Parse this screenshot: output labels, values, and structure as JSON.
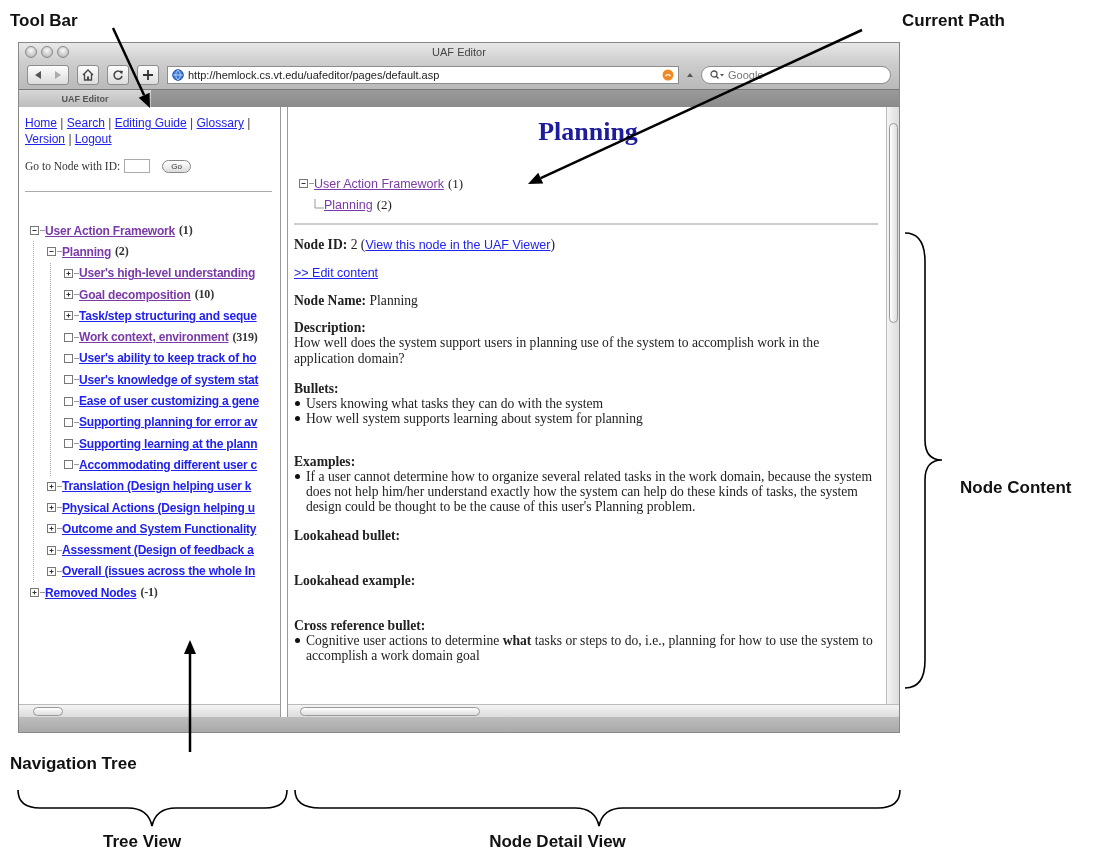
{
  "annotations": {
    "tool_bar": "Tool Bar",
    "current_path": "Current Path",
    "node_content": "Node Content",
    "navigation_tree": "Navigation Tree",
    "tree_view": "Tree View",
    "node_detail_view": "Node Detail View"
  },
  "window": {
    "title": "UAF Editor",
    "url": "http://hemlock.cs.vt.edu/uafeditor/pages/default.asp",
    "search_placeholder": "Google",
    "tabs": [
      {
        "label": "UAF Editor",
        "selected": true
      }
    ]
  },
  "tree_view": {
    "separator": "|",
    "links": [
      {
        "label": "Home"
      },
      {
        "label": "Search"
      },
      {
        "label": "Editing Guide"
      },
      {
        "label": "Glossary"
      },
      {
        "label": "Version"
      },
      {
        "label": "Logout"
      }
    ],
    "goto": {
      "label": "Go to Node with ID:",
      "button": "Go"
    },
    "tree": [
      {
        "label": "User Action Framework",
        "count": "(1)",
        "kind": "open",
        "visited": true,
        "children": [
          {
            "label": "Planning",
            "count": "(2)",
            "kind": "open",
            "visited": true,
            "children": [
              {
                "label": "User's high-level understanding",
                "kind": "closed",
                "visited": true
              },
              {
                "label": "Goal decomposition",
                "count": "(10)",
                "kind": "closed",
                "visited": true
              },
              {
                "label": "Task/step structuring and seque",
                "kind": "closed",
                "visited": false
              },
              {
                "label": "Work context, environment",
                "count": "(319)",
                "kind": "leaf",
                "visited": true
              },
              {
                "label": "User's ability to keep track of ho",
                "kind": "leaf",
                "visited": false
              },
              {
                "label": "User's knowledge of system stat",
                "kind": "leaf",
                "visited": false
              },
              {
                "label": "Ease of user customizing a gene",
                "kind": "leaf",
                "visited": false
              },
              {
                "label": "Supporting planning for error av",
                "kind": "leaf",
                "visited": false
              },
              {
                "label": "Supporting learning at the plann",
                "kind": "leaf",
                "visited": false
              },
              {
                "label": "Accommodating different user c",
                "kind": "leaf",
                "visited": false
              }
            ]
          },
          {
            "label": "Translation (Design helping user k",
            "kind": "closed",
            "visited": false
          },
          {
            "label": "Physical Actions (Design helping u",
            "kind": "closed",
            "visited": false
          },
          {
            "label": "Outcome and System Functionality",
            "kind": "closed",
            "visited": false
          },
          {
            "label": "Assessment (Design of feedback a",
            "kind": "closed",
            "visited": false
          },
          {
            "label": "Overall (issues across the whole In",
            "kind": "closed",
            "visited": false
          }
        ]
      },
      {
        "label": "Removed Nodes",
        "count": "(-1)",
        "kind": "closed",
        "visited": false
      }
    ]
  },
  "detail": {
    "title": "Planning",
    "path": [
      {
        "label": "User Action Framework",
        "count": "(1)",
        "children": [
          {
            "label": "Planning",
            "count": "(2)"
          }
        ]
      }
    ],
    "node_id": {
      "text": "**Node ID:** 2 (",
      "link": "View this node in the UAF Viewer",
      "after": ")"
    },
    "edit_link": ">> Edit content",
    "node_name": "**Node Name:** Planning",
    "sections": [
      {
        "heading": "Description:",
        "text": "How well does the system support users in planning use of the system to accomplish work in the application domain?"
      },
      {
        "heading": "Bullets:",
        "bullets": [
          "Users knowing what tasks they can do with the system",
          "How well system supports learning about system for planning"
        ]
      },
      {
        "heading": "Examples:",
        "bullets": [
          "If a user cannot determine how to organize several related tasks in the work domain, because the system does not help him/her understand exactly how the system can help do these kinds of tasks, the system design could be thought to be the cause of this user's Planning problem."
        ]
      },
      {
        "heading": "Lookahead bullet:"
      },
      {
        "heading": "Lookahead example:"
      },
      {
        "heading": "Cross reference bullet:",
        "bullets": [
          "Cognitive user actions to determine **what** tasks or steps to do, i.e., planning for how to use the system to accomplish a work domain goal"
        ]
      }
    ]
  }
}
